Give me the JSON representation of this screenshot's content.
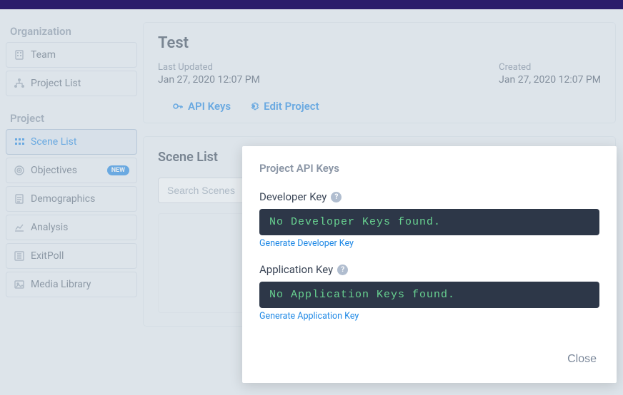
{
  "sidebar": {
    "section_org": "Organization",
    "section_project": "Project",
    "items_org": [
      {
        "label": "Team"
      },
      {
        "label": "Project List"
      }
    ],
    "items_project": [
      {
        "label": "Scene List"
      },
      {
        "label": "Objectives",
        "new_badge": "NEW"
      },
      {
        "label": "Demographics"
      },
      {
        "label": "Analysis"
      },
      {
        "label": "ExitPoll"
      },
      {
        "label": "Media Library"
      }
    ]
  },
  "project": {
    "title": "Test",
    "last_updated_label": "Last Updated",
    "last_updated_value": "Jan 27, 2020 12:07 PM",
    "created_label": "Created",
    "created_value": "Jan 27, 2020 12:07 PM",
    "api_keys_label": "API Keys",
    "edit_project_label": "Edit Project"
  },
  "scene": {
    "title": "Scene List",
    "search_placeholder": "Search Scenes"
  },
  "modal": {
    "title": "Project API Keys",
    "dev_label": "Developer Key",
    "dev_msg": "No Developer Keys found.",
    "dev_gen": "Generate Developer Key",
    "app_label": "Application Key",
    "app_msg": "No Application Keys found.",
    "app_gen": "Generate Application Key",
    "close": "Close",
    "help": "?"
  }
}
